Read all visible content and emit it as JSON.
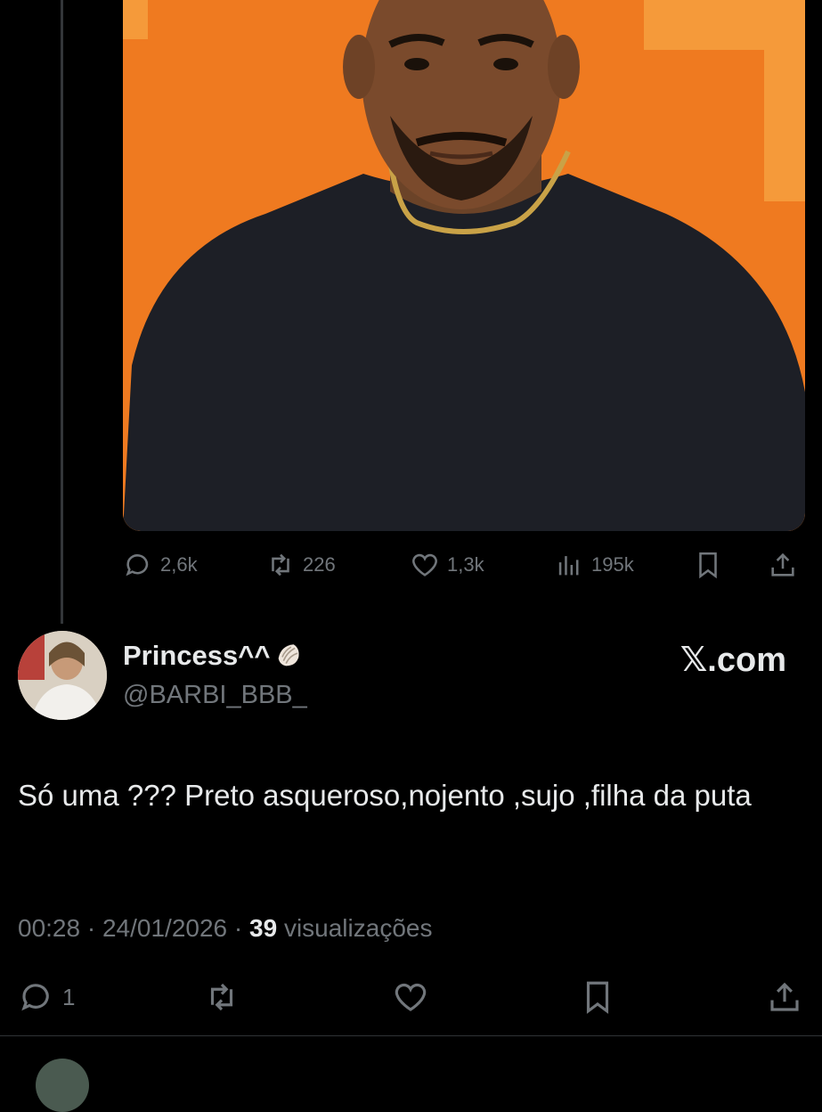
{
  "post": {
    "stats": {
      "replies": "2,6k",
      "reposts": "226",
      "likes": "1,3k",
      "views": "195k"
    }
  },
  "reply": {
    "display_name": "Princess^^",
    "handle": "@BARBI_BBB_",
    "brand": "𝕏.com",
    "text": "Só uma ??? Preto asqueroso,nojento ,sujo ,filha da puta",
    "time": "00:28",
    "date": "24/01/2026",
    "views_count": "39",
    "views_label": "visualizações",
    "stats": {
      "replies": "1"
    }
  },
  "colors": {
    "background": "#000000",
    "text_primary": "#e7e9ea",
    "text_secondary": "#71767b",
    "image_background": "#f07a1e"
  },
  "icons": [
    "reply-icon",
    "repost-icon",
    "like-icon",
    "views-icon",
    "bookmark-icon",
    "share-icon",
    "shell-emoji-icon"
  ]
}
